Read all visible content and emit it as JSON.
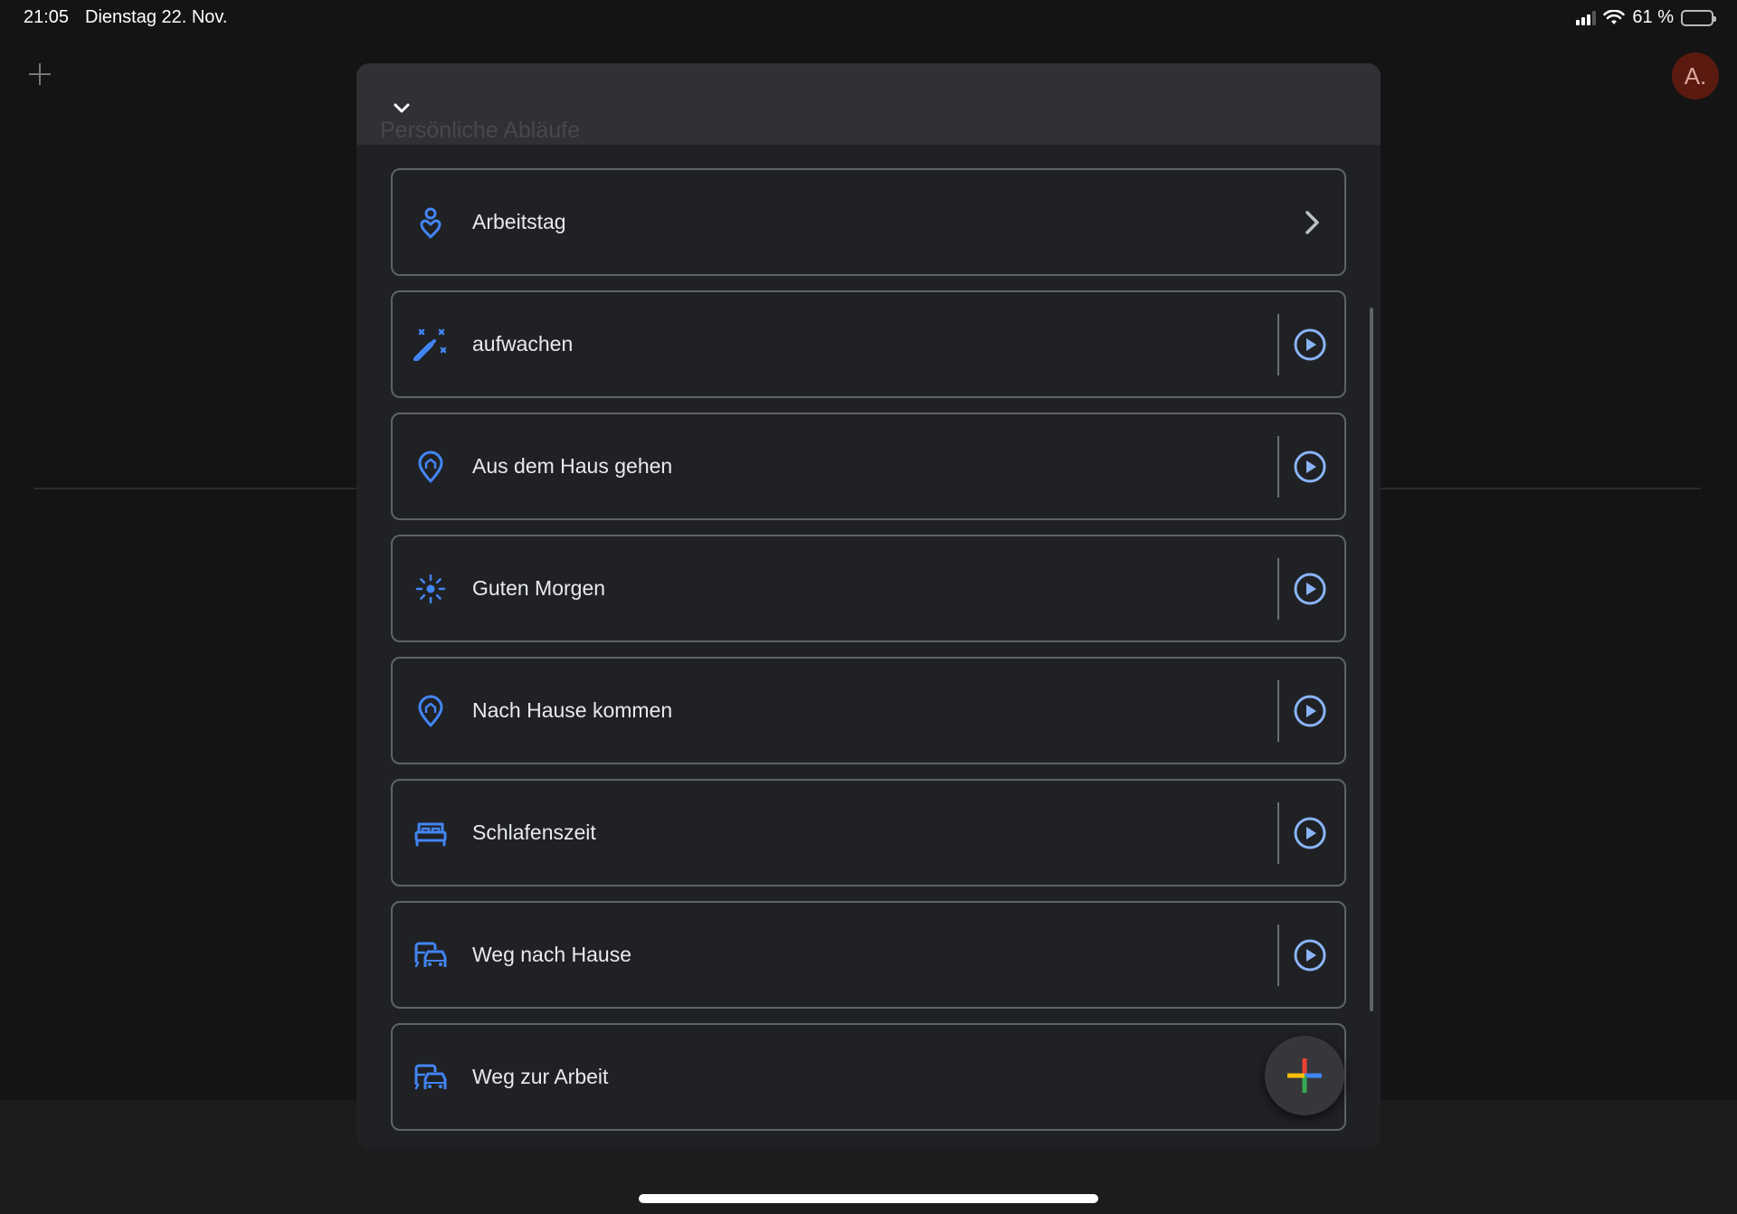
{
  "status_bar": {
    "time": "21:05",
    "date": "Dienstag 22. Nov.",
    "battery": "61 %",
    "battery_level": 0.61
  },
  "background_app": {
    "avatar_initial": "A."
  },
  "sheet": {
    "title": "Persönliche Abläufe",
    "items": [
      {
        "label": "Arbeitstag",
        "icon": "person-pin-icon",
        "action": "chevron-right-icon"
      },
      {
        "label": "aufwachen",
        "icon": "magic-wand-icon",
        "action": "play-circle-icon"
      },
      {
        "label": "Aus dem Haus gehen",
        "icon": "location-pin-icon",
        "action": "play-circle-icon"
      },
      {
        "label": "Guten Morgen",
        "icon": "sun-icon",
        "action": "play-circle-icon"
      },
      {
        "label": "Nach Hause kommen",
        "icon": "location-pin-icon",
        "action": "play-circle-icon"
      },
      {
        "label": "Schlafenszeit",
        "icon": "bed-icon",
        "action": "play-circle-icon"
      },
      {
        "label": "Weg nach Hause",
        "icon": "commute-icon",
        "action": "play-circle-icon"
      },
      {
        "label": "Weg zur Arbeit",
        "icon": "commute-icon",
        "action": "play-circle-icon"
      }
    ]
  },
  "colors": {
    "accent_blue": "#4285f4",
    "play_blue": "#8ab4f8",
    "google_red": "#ea4335",
    "google_yellow": "#fbbc04",
    "google_green": "#34a853",
    "google_blue": "#4285f4"
  }
}
